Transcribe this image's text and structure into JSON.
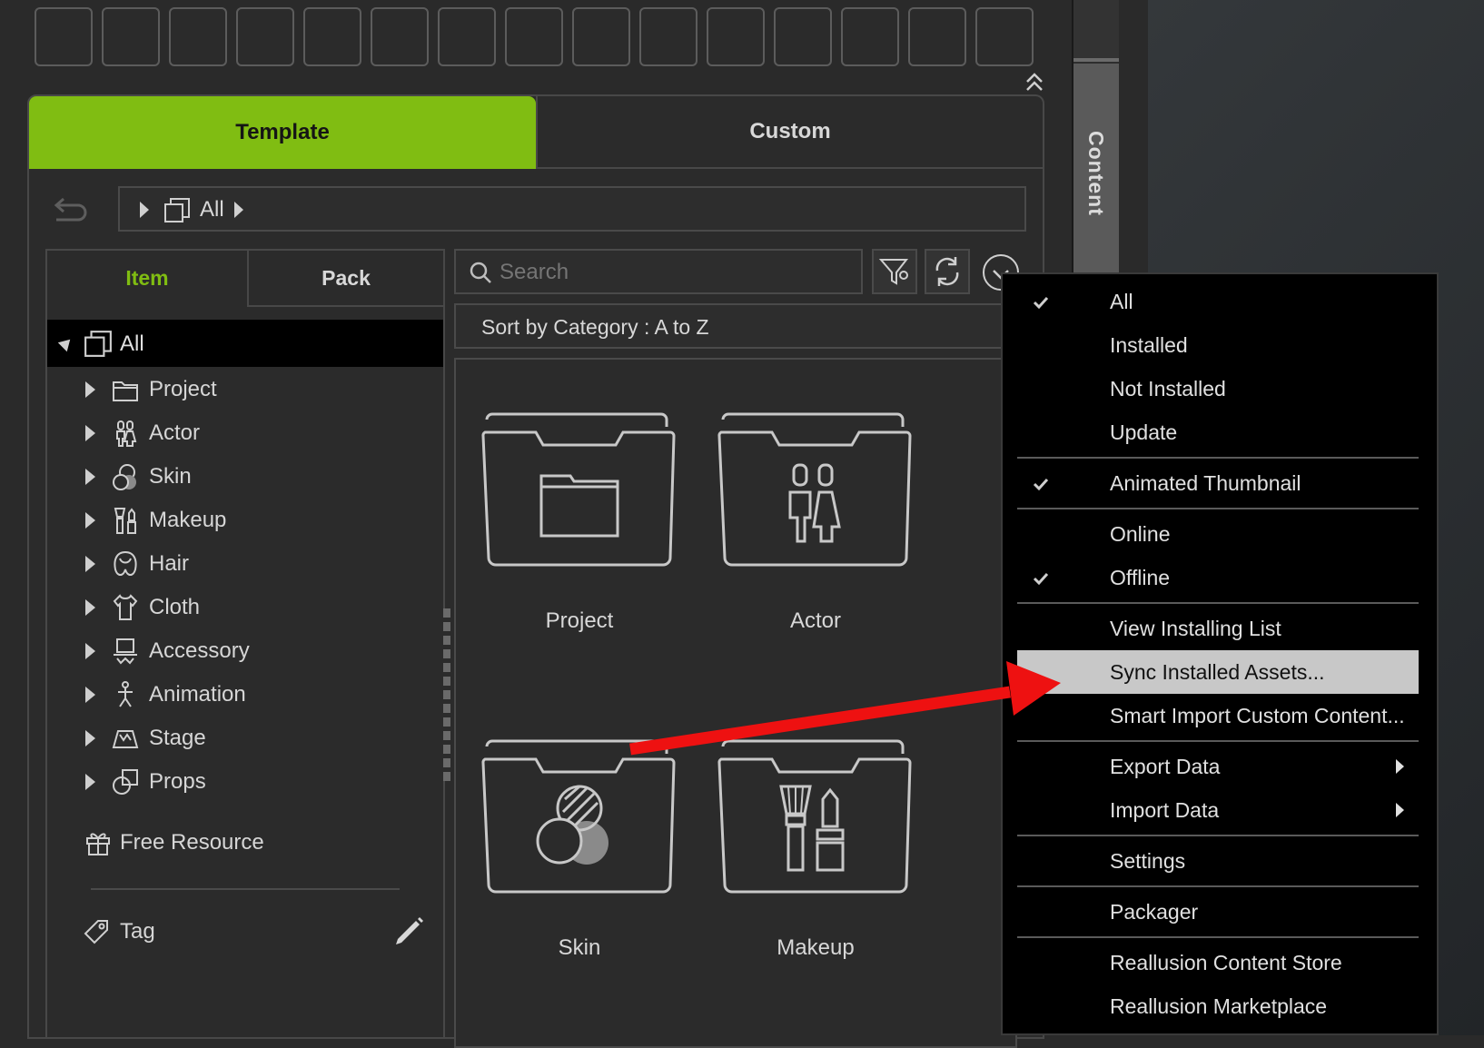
{
  "tabs": {
    "template": "Template",
    "custom": "Custom"
  },
  "breadcrumb": {
    "root": "All"
  },
  "side_tabs": {
    "item": "Item",
    "pack": "Pack"
  },
  "vertical_tab": "Content",
  "tree": {
    "root": "All",
    "items": [
      {
        "label": "Project",
        "icon": "folder-icon"
      },
      {
        "label": "Actor",
        "icon": "actor-icon"
      },
      {
        "label": "Skin",
        "icon": "skin-icon"
      },
      {
        "label": "Makeup",
        "icon": "makeup-icon"
      },
      {
        "label": "Hair",
        "icon": "hair-icon"
      },
      {
        "label": "Cloth",
        "icon": "cloth-icon"
      },
      {
        "label": "Accessory",
        "icon": "accessory-icon"
      },
      {
        "label": "Animation",
        "icon": "animation-icon"
      },
      {
        "label": "Stage",
        "icon": "stage-icon"
      },
      {
        "label": "Props",
        "icon": "props-icon"
      }
    ],
    "free_resource": "Free Resource",
    "tag": "Tag"
  },
  "search": {
    "placeholder": "Search"
  },
  "sort_label": "Sort by Category : A to Z",
  "tiles": [
    "Project",
    "Actor",
    "Skin",
    "Makeup"
  ],
  "menu": {
    "groups": [
      [
        {
          "label": "All",
          "checked": true
        },
        {
          "label": "Installed",
          "checked": false
        },
        {
          "label": "Not Installed",
          "checked": false
        },
        {
          "label": "Update",
          "checked": false
        }
      ],
      [
        {
          "label": "Animated Thumbnail",
          "checked": true
        }
      ],
      [
        {
          "label": "Online",
          "checked": false
        },
        {
          "label": "Offline",
          "checked": true
        }
      ],
      [
        {
          "label": "View Installing List",
          "checked": false
        },
        {
          "label": "Sync Installed Assets...",
          "checked": false,
          "highlighted": true
        },
        {
          "label": "Smart Import Custom Content...",
          "checked": false
        }
      ],
      [
        {
          "label": "Export Data",
          "checked": false,
          "submenu": true
        },
        {
          "label": "Import Data",
          "checked": false,
          "submenu": true
        }
      ],
      [
        {
          "label": "Settings",
          "checked": false
        }
      ],
      [
        {
          "label": "Packager",
          "checked": false
        }
      ],
      [
        {
          "label": "Reallusion Content Store",
          "checked": false
        },
        {
          "label": "Reallusion Marketplace",
          "checked": false
        }
      ]
    ]
  },
  "colors": {
    "accent_green": "#80bd12",
    "annotation_arrow": "#ee1111",
    "menu_bg": "#000000",
    "menu_highlight": "#c8c8c8"
  }
}
